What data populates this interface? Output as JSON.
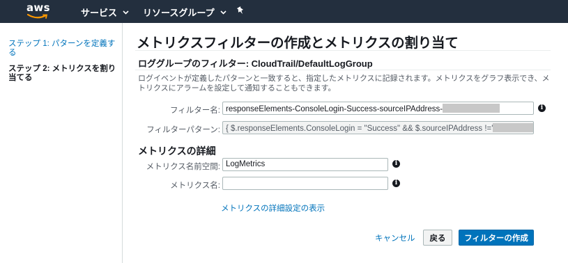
{
  "topbar": {
    "logo_text": "aws",
    "services_label": "サービス",
    "resource_groups_label": "リソースグループ",
    "colors": {
      "background": "#232f3e",
      "smile": "#ff9900"
    }
  },
  "sidebar": {
    "steps": [
      {
        "label": "ステップ 1: パターンを定義する",
        "state": "link"
      },
      {
        "label": "ステップ 2: メトリクスを割り当てる",
        "state": "current"
      }
    ]
  },
  "main": {
    "title": "メトリクスフィルターの作成とメトリクスの割り当て",
    "subtitle": "ロググループのフィルター: CloudTrail/DefaultLogGroup",
    "description": "ログイベントが定義したパターンと一致すると、指定したメトリクスに記録されます。メトリクスをグラフ表示でき、メトリクスにアラームを設定して通知することもできます。",
    "filter_name": {
      "label": "フィルター名:",
      "value": "responseElements-ConsoleLogin-Success-sourceIPAddress-"
    },
    "filter_pattern": {
      "label": "フィルターパターン:",
      "value": "{ $.responseElements.ConsoleLogin = \"Success\" && $.sourceIPAddress !='"
    },
    "metrics_section": {
      "heading": "メトリクスの詳細",
      "namespace": {
        "label": "メトリクス名前空間:",
        "value": "LogMetrics"
      },
      "metric_name": {
        "label": "メトリクス名:",
        "value": ""
      }
    },
    "advanced_link": "メトリクスの詳細設定の表示",
    "actions": {
      "cancel": "キャンセル",
      "back": "戻る",
      "create": "フィルターの作成"
    },
    "colors": {
      "link": "#0073bb",
      "primary_button": "#0073bb"
    }
  }
}
